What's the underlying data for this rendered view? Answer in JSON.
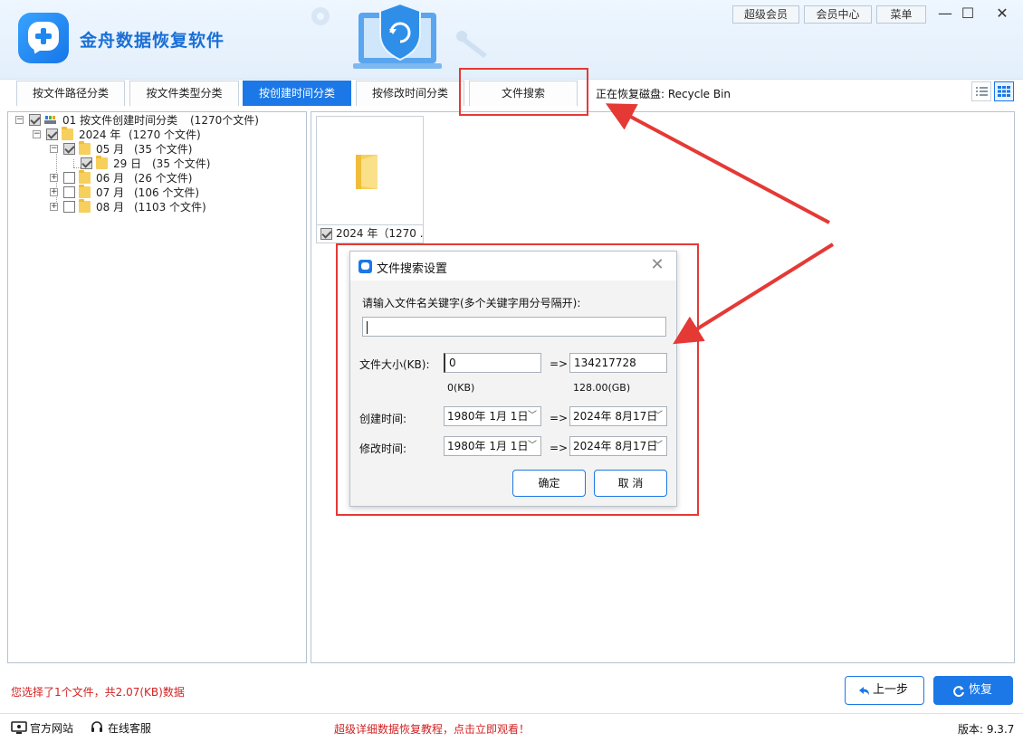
{
  "app": {
    "title": "金舟数据恢复软件",
    "top_buttons": [
      "超级会员",
      "会员中心",
      "菜单"
    ],
    "window_controls": {
      "minimize": "—",
      "maximize": "☐",
      "close": "✕"
    }
  },
  "tabs": [
    {
      "label": "按文件路径分类",
      "active": false
    },
    {
      "label": "按文件类型分类",
      "active": false
    },
    {
      "label": "按创建时间分类",
      "active": true
    },
    {
      "label": "按修改时间分类",
      "active": false
    },
    {
      "label": "文件搜索",
      "active": false
    }
  ],
  "recover_disk": "正在恢复磁盘: Recycle Bin",
  "tree": {
    "root": {
      "label": "01 按文件创建时间分类",
      "count": "(1270个文件)"
    },
    "year": {
      "label": "2024 年",
      "count": "(1270 个文件)"
    },
    "months": [
      {
        "label": "05 月",
        "count": "(35 个文件)"
      },
      {
        "label": "06 月",
        "count": "(26 个文件)"
      },
      {
        "label": "07 月",
        "count": "(106 个文件)"
      },
      {
        "label": "08 月",
        "count": "(1103 个文件)"
      }
    ],
    "day": {
      "label": "29 日",
      "count": "(35 个文件)"
    }
  },
  "thumbnail": {
    "caption": "2024 年（1270 ..."
  },
  "dialog": {
    "title": "文件搜索设置",
    "close": "✕",
    "keyword_label": "请输入文件名关键字(多个关键字用分号隔开):",
    "keyword_value": "",
    "size_label": "文件大小(KB):",
    "size_min": "0",
    "size_max": "134217728",
    "size_min_hint": "0(KB)",
    "size_max_hint": "128.00(GB)",
    "arrow": "=>",
    "created_label": "创建时间:",
    "created_from": "1980年 1月 1日",
    "created_to": "2024年 8月17日",
    "modified_label": "修改时间:",
    "modified_from": "1980年 1月 1日",
    "modified_to": "2024年 8月17日",
    "ok": "确定",
    "cancel": "取 消"
  },
  "status": "您选择了1个文件，共2.07(KB)数据",
  "buttons": {
    "prev": "上一步",
    "recover": "恢复"
  },
  "footer": {
    "website": "官方网站",
    "service": "在线客服",
    "promo": "超级详细数据恢复教程，点击立即观看！",
    "version": "版本: 9.3.7"
  },
  "colors": {
    "accent": "#1b78e6",
    "annotation": "#e53935",
    "alert_text": "#d32222"
  }
}
